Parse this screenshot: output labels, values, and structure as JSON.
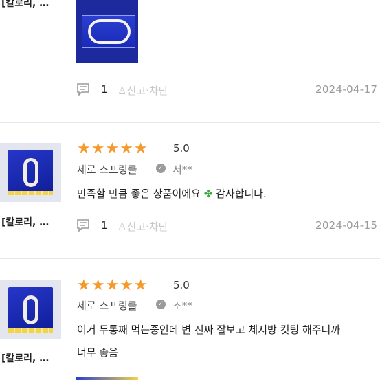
{
  "product_label": "[칼로리, …",
  "report_label": "신고·차단",
  "reviews": [
    {
      "comment_count": "1",
      "date": "2024-04-17"
    },
    {
      "stars": "★★★★★",
      "rating": "5.0",
      "product": "제로 스프링클",
      "user": "서**",
      "text": "만족할 만큼 좋은 상품이에요",
      "text_tail": "감사합니다.",
      "comment_count": "1",
      "date": "2024-04-15"
    },
    {
      "stars": "★★★★★",
      "rating": "5.0",
      "product": "제로 스프링클",
      "user": "조**",
      "text_line1": "이거 두통째 먹는중인데 변 진짜 잘보고 체지방 컷팅 해주니까",
      "text_line2": "너무 좋음"
    }
  ],
  "colors": {
    "star": "#f49a2c",
    "clover": "#3aa83a"
  }
}
